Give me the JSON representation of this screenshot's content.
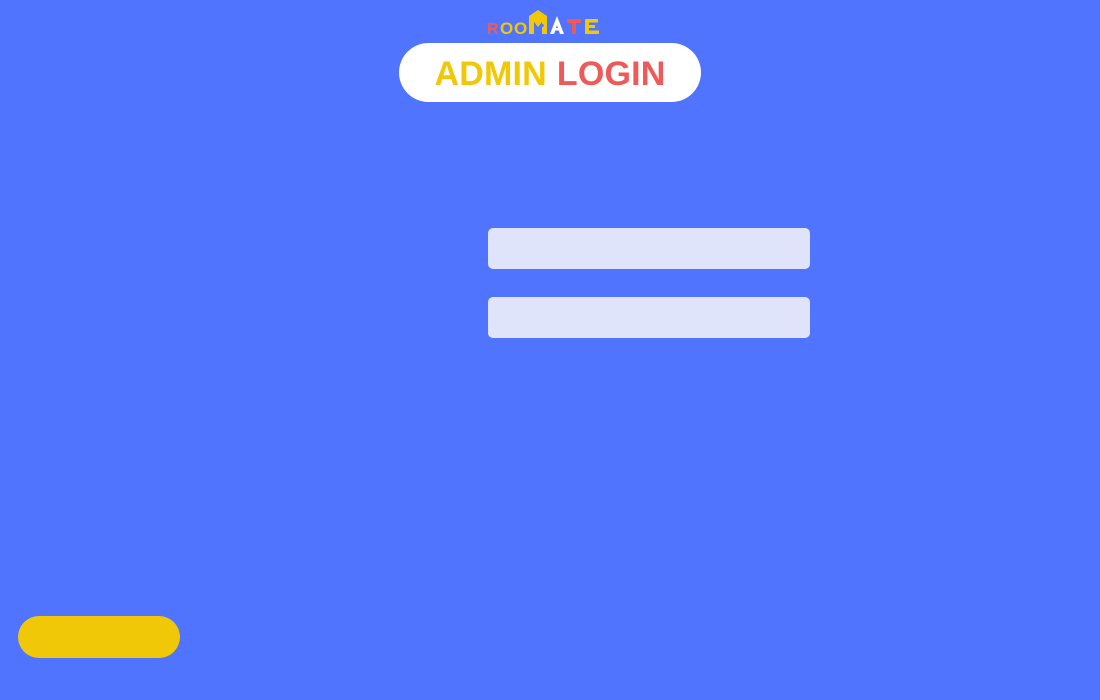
{
  "logo": {
    "text": "ROOMATE",
    "letters": [
      "R",
      "O",
      "O",
      "M",
      "A",
      "T",
      "E"
    ],
    "colors": {
      "red": "#ee5a5a",
      "yellow": "#f0c808",
      "white": "#ffffff"
    }
  },
  "header": {
    "title_part1": "ADMIN",
    "title_part2": "LOGIN",
    "title_part1_color": "#f0c808",
    "title_part2_color": "#ee5a5a"
  },
  "form": {
    "username": {
      "value": "",
      "placeholder": ""
    },
    "password": {
      "value": "",
      "placeholder": ""
    }
  },
  "footer": {
    "back_button_label": ""
  },
  "colors": {
    "background": "#5174ff",
    "field_background": "#dfe4fb",
    "accent_yellow": "#f0c808",
    "accent_red": "#ee5a5a"
  }
}
